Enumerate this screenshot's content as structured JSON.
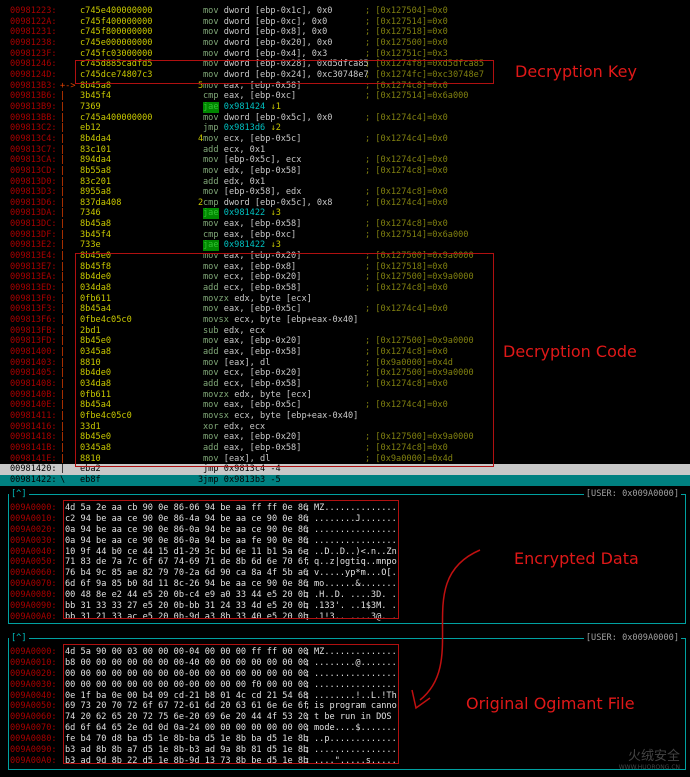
{
  "disasm": [
    {
      "addr": "00981223:",
      "mark": "",
      "bytes": "c745e400000000",
      "pre": "",
      "mn": "mov",
      "ops": "dword [ebp-0x1c], 0x0",
      "cmt": "; [0x127504]=0x0"
    },
    {
      "addr": "0098122A:",
      "mark": "",
      "bytes": "c745f400000000",
      "pre": "",
      "mn": "mov",
      "ops": "dword [ebp-0xc], 0x0",
      "cmt": "; [0x127514]=0x0"
    },
    {
      "addr": "00981231:",
      "mark": "",
      "bytes": "c745f800000000",
      "pre": "",
      "mn": "mov",
      "ops": "dword [ebp-0x8], 0x0",
      "cmt": "; [0x127518]=0x0"
    },
    {
      "addr": "00981238:",
      "mark": "",
      "bytes": "c745e000000000",
      "pre": "",
      "mn": "mov",
      "ops": "dword [ebp-0x20], 0x0",
      "cmt": "; [0x127500]=0x0"
    },
    {
      "addr": "0098123F:",
      "mark": "",
      "bytes": "c745fc03000000",
      "pre": "",
      "mn": "mov",
      "ops": "dword [ebp-0x4], 0x3",
      "cmt": "; [0x12751c]=0x3"
    },
    {
      "addr": "00981246:",
      "mark": "",
      "bytes": "c745d885cadfd5",
      "pre": "",
      "mn": "mov",
      "ops": "dword [ebp-0x28], 0xd5dfca85",
      "cmt": "; [0x1274f8]=0xd5dfca85"
    },
    {
      "addr": "0098124D:",
      "mark": "",
      "bytes": "c745dce74807c3",
      "pre": "",
      "mn": "mov",
      "ops": "dword [ebp-0x24], 0xc30748e7",
      "cmt": "; [0x1274fc]=0xc30748e7"
    },
    {
      "addr": "009813B3:",
      "mark": "+->",
      "bytes": "8b45a8",
      "pre": "5",
      "mn": "mov",
      "ops": "eax, [ebp-0x58]",
      "cmt": "; [0x1274c8]=0x0"
    },
    {
      "addr": "009813B6:",
      "mark": "|",
      "bytes": "3b45f4",
      "pre": "",
      "mn": "cmp",
      "ops": "eax, [ebp-0xc]",
      "cmt": "; [0x127514]=0x6a000"
    },
    {
      "addr": "009813B9:",
      "mark": "|",
      "bytes": "7369",
      "pre": "",
      "mn": "jae",
      "ops": "0x981424",
      "arrow": "↓1",
      "cmt": ""
    },
    {
      "addr": "009813BB:",
      "mark": "|",
      "bytes": "c745a400000000",
      "pre": "",
      "mn": "mov",
      "ops": "dword [ebp-0x5c], 0x0",
      "cmt": "; [0x1274c4]=0x0"
    },
    {
      "addr": "009813C2:",
      "mark": "|",
      "bytes": "eb12",
      "pre": "",
      "mn": "jmp",
      "ops": "0x9813d6",
      "arrow": "↓2",
      "cmt": ""
    },
    {
      "addr": "009813C4:",
      "mark": "|",
      "bytes": "8b4da4",
      "pre": "4",
      "mn": "mov",
      "ops": "ecx, [ebp-0x5c]",
      "cmt": "; [0x1274c4]=0x0"
    },
    {
      "addr": "009813C7:",
      "mark": "|",
      "bytes": "83c101",
      "pre": "",
      "mn": "add",
      "ops": "ecx, 0x1",
      "cmt": ""
    },
    {
      "addr": "009813CA:",
      "mark": "|",
      "bytes": "894da4",
      "pre": "",
      "mn": "mov",
      "ops": "[ebp-0x5c], ecx",
      "cmt": "; [0x1274c4]=0x0"
    },
    {
      "addr": "009813CD:",
      "mark": "|",
      "bytes": "8b55a8",
      "pre": "",
      "mn": "mov",
      "ops": "edx, [ebp-0x58]",
      "cmt": "; [0x1274c8]=0x0"
    },
    {
      "addr": "009813D0:",
      "mark": "|",
      "bytes": "83c201",
      "pre": "",
      "mn": "add",
      "ops": "edx, 0x1",
      "cmt": ""
    },
    {
      "addr": "009813D3:",
      "mark": "|",
      "bytes": "8955a8",
      "pre": "",
      "mn": "mov",
      "ops": "[ebp-0x58], edx",
      "cmt": "; [0x1274c8]=0x0"
    },
    {
      "addr": "009813D6:",
      "mark": "|",
      "bytes": "837da408",
      "pre": "2",
      "mn": "cmp",
      "ops": "dword [ebp-0x5c], 0x8",
      "cmt": "; [0x1274c4]=0x0"
    },
    {
      "addr": "009813DA:",
      "mark": "|",
      "bytes": "7346",
      "pre": "",
      "mn": "jae",
      "ops": "0x981422",
      "arrow": "↓3",
      "cmt": ""
    },
    {
      "addr": "009813DC:",
      "mark": "|",
      "bytes": "8b45a8",
      "pre": "",
      "mn": "mov",
      "ops": "eax, [ebp-0x58]",
      "cmt": "; [0x1274c8]=0x0"
    },
    {
      "addr": "009813DF:",
      "mark": "|",
      "bytes": "3b45f4",
      "pre": "",
      "mn": "cmp",
      "ops": "eax, [ebp-0xc]",
      "cmt": "; [0x127514]=0x6a000"
    },
    {
      "addr": "009813E2:",
      "mark": "|",
      "bytes": "733e",
      "pre": "",
      "mn": "jae",
      "ops": "0x981422",
      "arrow": "↓3",
      "cmt": ""
    },
    {
      "addr": "009813E4:",
      "mark": "|",
      "bytes": "8b45e0",
      "pre": "",
      "mn": "mov",
      "ops": "eax, [ebp-0x20]",
      "cmt": "; [0x127500]=0x9a0000"
    },
    {
      "addr": "009813E7:",
      "mark": "|",
      "bytes": "8b45f8",
      "pre": "",
      "mn": "mov",
      "ops": "eax, [ebp-0x8]",
      "cmt": "; [0x127518]=0x0"
    },
    {
      "addr": "009813EA:",
      "mark": "|",
      "bytes": "8b4de0",
      "pre": "",
      "mn": "mov",
      "ops": "ecx, [ebp-0x20]",
      "cmt": "; [0x127500]=0x9a0000"
    },
    {
      "addr": "009813ED:",
      "mark": "|",
      "bytes": "034da8",
      "pre": "",
      "mn": "add",
      "ops": "ecx, [ebp-0x58]",
      "cmt": "; [0x1274c8]=0x0"
    },
    {
      "addr": "009813F0:",
      "mark": "|",
      "bytes": "0fb611",
      "pre": "",
      "mn": "movzx",
      "ops": "edx, byte [ecx]",
      "cmt": ""
    },
    {
      "addr": "009813F3:",
      "mark": "|",
      "bytes": "8b45a4",
      "pre": "",
      "mn": "mov",
      "ops": "eax, [ebp-0x5c]",
      "cmt": "; [0x1274c4]=0x0"
    },
    {
      "addr": "009813F6:",
      "mark": "|",
      "bytes": "0fbe4c05c0",
      "pre": "",
      "mn": "movsx",
      "ops": "ecx, byte [ebp+eax-0x40]",
      "cmt": ""
    },
    {
      "addr": "009813FB:",
      "mark": "|",
      "bytes": "2bd1",
      "pre": "",
      "mn": "sub",
      "ops": "edx, ecx",
      "cmt": ""
    },
    {
      "addr": "009813FD:",
      "mark": "|",
      "bytes": "8b45e0",
      "pre": "",
      "mn": "mov",
      "ops": "eax, [ebp-0x20]",
      "cmt": "; [0x127500]=0x9a0000"
    },
    {
      "addr": "00981400:",
      "mark": "|",
      "bytes": "0345a8",
      "pre": "",
      "mn": "add",
      "ops": "eax, [ebp-0x58]",
      "cmt": "; [0x1274c8]=0x0"
    },
    {
      "addr": "00981403:",
      "mark": "|",
      "bytes": "8810",
      "pre": "",
      "mn": "mov",
      "ops": "[eax], dl",
      "cmt": "; [0x9a0000]=0x4d"
    },
    {
      "addr": "00981405:",
      "mark": "|",
      "bytes": "8b4de0",
      "pre": "",
      "mn": "mov",
      "ops": "ecx, [ebp-0x20]",
      "cmt": "; [0x127500]=0x9a0000"
    },
    {
      "addr": "00981408:",
      "mark": "|",
      "bytes": "034da8",
      "pre": "",
      "mn": "add",
      "ops": "ecx, [ebp-0x58]",
      "cmt": "; [0x1274c8]=0x0"
    },
    {
      "addr": "0098140B:",
      "mark": "|",
      "bytes": "0fb611",
      "pre": "",
      "mn": "movzx",
      "ops": "edx, byte [ecx]",
      "cmt": ""
    },
    {
      "addr": "0098140E:",
      "mark": "|",
      "bytes": "8b45a4",
      "pre": "",
      "mn": "mov",
      "ops": "eax, [ebp-0x5c]",
      "cmt": "; [0x1274c4]=0x0"
    },
    {
      "addr": "00981411:",
      "mark": "|",
      "bytes": "0fbe4c05c0",
      "pre": "",
      "mn": "movsx",
      "ops": "ecx, byte [ebp+eax-0x40]",
      "cmt": ""
    },
    {
      "addr": "00981416:",
      "mark": "|",
      "bytes": "33d1",
      "pre": "",
      "mn": "xor",
      "ops": "edx, ecx",
      "cmt": ""
    },
    {
      "addr": "00981418:",
      "mark": "|",
      "bytes": "8b45e0",
      "pre": "",
      "mn": "mov",
      "ops": "eax, [ebp-0x20]",
      "cmt": "; [0x127500]=0x9a0000"
    },
    {
      "addr": "0098141B:",
      "mark": "|",
      "bytes": "0345a8",
      "pre": "",
      "mn": "add",
      "ops": "eax, [ebp-0x58]",
      "cmt": "; [0x1274c8]=0x0"
    },
    {
      "addr": "0098141E:",
      "mark": "|",
      "bytes": "8810",
      "pre": "",
      "mn": "mov",
      "ops": "[eax], dl",
      "cmt": "; [0x9a0000]=0x4d"
    },
    {
      "addr": "00981420:",
      "mark": "|",
      "bytes": "eba2",
      "pre": "",
      "mn": "jmp",
      "ops": "0x9813c4 -4",
      "cmt": "",
      "state": "selected"
    },
    {
      "addr": "00981422:",
      "mark": "\\",
      "bytes": "eb8f",
      "pre": "3",
      "mn": "jmp",
      "ops": "0x9813b3 -5",
      "cmt": "",
      "state": "current"
    }
  ],
  "panels": [
    {
      "tag": "[^]",
      "user": "[USER: 0x009A0000]",
      "rows": [
        {
          "addr": "009A0000:",
          "hex": "4d 5a 2e aa cb 90 0e 86-06 94 be aa ff ff 0e 86",
          "ascii": "MZ.............."
        },
        {
          "addr": "009A0010:",
          "hex": "c2 94 be aa ce 90 0e 86-4a 94 be aa ce 90 0e 86",
          "ascii": "........J......."
        },
        {
          "addr": "009A0020:",
          "hex": "0a 94 be aa ce 90 0e 86-0a 94 be aa ce 90 0e 86",
          "ascii": "................"
        },
        {
          "addr": "009A0030:",
          "hex": "0a 94 be aa ce 90 0e 86-0a 94 be aa fe 90 0e 86",
          "ascii": "................"
        },
        {
          "addr": "009A0040:",
          "hex": "10 9f 44 b0 ce 44 15 d1-29 3c bd 6e 11 b1 5a 6e",
          "ascii": "..D..D..)<.n..Zn"
        },
        {
          "addr": "009A0050:",
          "hex": "71 83 de 7a 7c 6f 67 74-69 71 de 8b 6d 6e 70 6f",
          "ascii": "q..z|ogtiq..mnpo"
        },
        {
          "addr": "009A0060:",
          "hex": "76 b4 9c 85 ae 82 79 70-2a 6d 90 ca 8a 4f 5b a6",
          "ascii": "v.....yp*m...O[."
        },
        {
          "addr": "009A0070:",
          "hex": "6d 6f 9a 85 b0 8d 11 8c-26 94 be aa ce 90 0e 86",
          "ascii": "mo......&......."
        },
        {
          "addr": "009A0080:",
          "hex": "00 48 8e e2 44 e5 20 0b-c4 e9 a0 33 44 e5 20 0b",
          "ascii": ".H..D. ....3D. ."
        },
        {
          "addr": "009A0090:",
          "hex": "bb 31 33 33 27 e5 20 0b-bb 31 24 33 4d e5 20 0b",
          "ascii": ".133'. ..1$3M. ."
        },
        {
          "addr": "009A00A0:",
          "hex": "bb 31 21 33 ac e5 20 0b-9d a3 8b 33 40 e5 20 0b",
          "ascii": ".1!3.. ....3@. ."
        }
      ]
    },
    {
      "tag": "[^]",
      "user": "[USER: 0x009A0000]",
      "rows": [
        {
          "addr": "009A0000:",
          "hex": "4d 5a 90 00 03 00 00 00-04 00 00 00 ff ff 00 00",
          "ascii": "MZ.............."
        },
        {
          "addr": "009A0010:",
          "hex": "b8 00 00 00 00 00 00 00-40 00 00 00 00 00 00 00",
          "ascii": "........@......."
        },
        {
          "addr": "009A0020:",
          "hex": "00 00 00 00 00 00 00 00-00 00 00 00 00 00 00 00",
          "ascii": "................"
        },
        {
          "addr": "009A0030:",
          "hex": "00 00 00 00 00 00 00 00-00 00 00 00 f0 00 00 00",
          "ascii": "................"
        },
        {
          "addr": "009A0040:",
          "hex": "0e 1f ba 0e 00 b4 09 cd-21 b8 01 4c cd 21 54 68",
          "ascii": "........!..L.!Th"
        },
        {
          "addr": "009A0050:",
          "hex": "69 73 20 70 72 6f 67 72-61 6d 20 63 61 6e 6e 6f",
          "ascii": "is program canno"
        },
        {
          "addr": "009A0060:",
          "hex": "74 20 62 65 20 72 75 6e-20 69 6e 20 44 4f 53 20",
          "ascii": "t be run in DOS "
        },
        {
          "addr": "009A0070:",
          "hex": "6d 6f 64 65 2e 0d 0d 0a-24 00 00 00 00 00 00 00",
          "ascii": "mode....$......."
        },
        {
          "addr": "009A0080:",
          "hex": "fe b4 70 d8 ba d5 1e 8b-ba d5 1e 8b ba d5 1e 8b",
          "ascii": "..p............."
        },
        {
          "addr": "009A0090:",
          "hex": "b3 ad 8b 8b a7 d5 1e 8b-b3 ad 9a 8b 81 d5 1e 8b",
          "ascii": "................"
        },
        {
          "addr": "009A00A0:",
          "hex": "b3 ad 9d 8b 22 d5 1e 8b-9d 13 73 8b be d5 1e 8b",
          "ascii": "....\".....s....."
        }
      ]
    }
  ],
  "annotations": {
    "key": "Decryption Key",
    "code": "Decryption Code",
    "encrypted": "Encrypted Data",
    "original": "Original Ogimant File"
  },
  "watermark": {
    "name": "火绒安全",
    "url": "WWW.HUORONG.CN"
  },
  "colors": {
    "annotation": "#e01818",
    "panel_border": "#00a0a0",
    "address": "#a80000",
    "bytes": "#c8c800",
    "selected_row": "#c8c8c8",
    "current_row": "#008080"
  }
}
